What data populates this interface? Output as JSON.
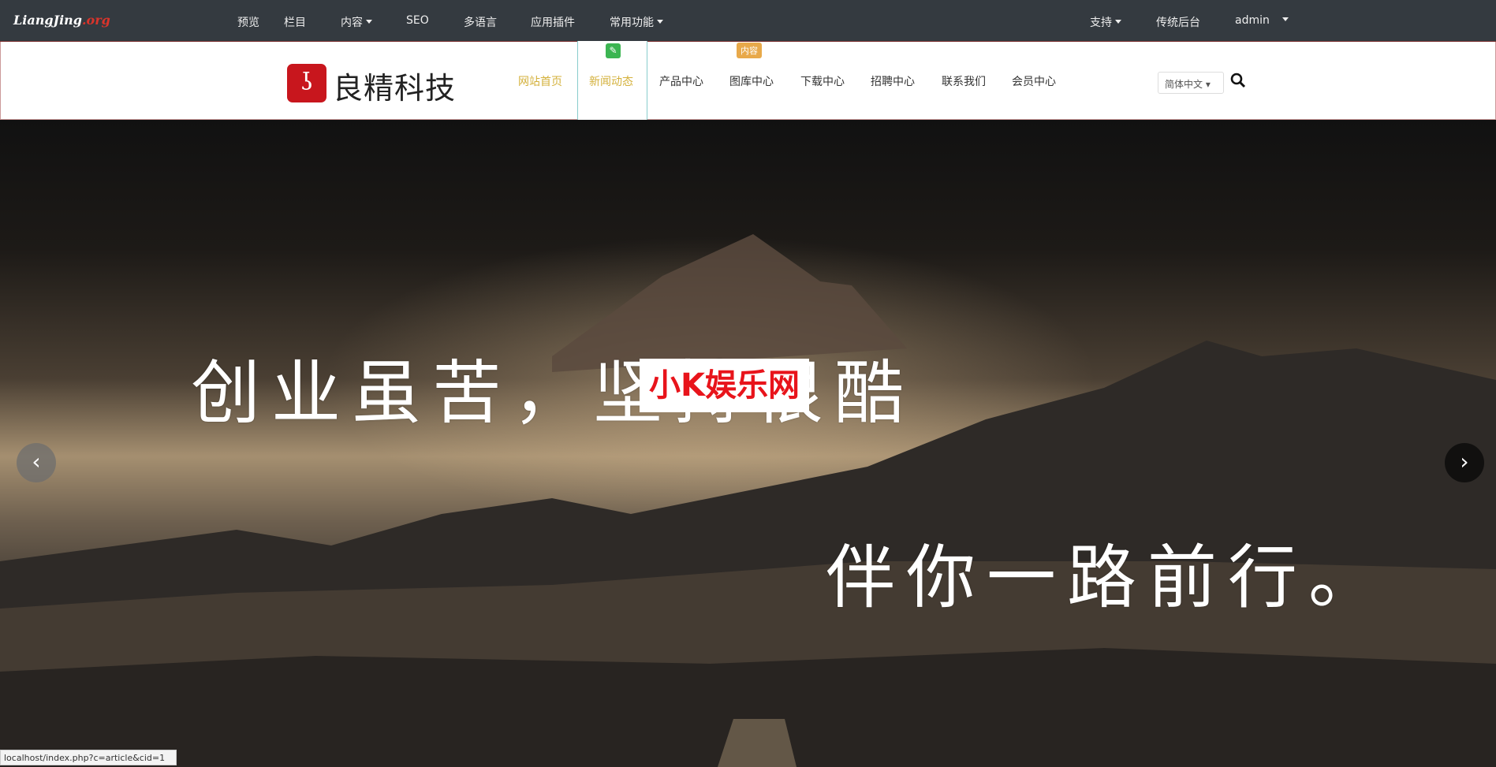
{
  "topbar": {
    "brand_main": "LiangJing",
    "brand_suffix": ".org",
    "items": [
      {
        "label": "预览"
      },
      {
        "label": "栏目"
      },
      {
        "label": "内容"
      },
      {
        "label": "SEO"
      },
      {
        "label": "多语言"
      },
      {
        "label": "应用插件"
      },
      {
        "label": "常用功能"
      }
    ],
    "right": [
      {
        "label": "支持"
      },
      {
        "label": "传统后台"
      },
      {
        "label": "admin"
      }
    ]
  },
  "header": {
    "logo_text": "良精科技",
    "nav": [
      {
        "label": "网站首页"
      },
      {
        "label": "新闻动态"
      },
      {
        "label": "产品中心"
      },
      {
        "label": "图库中心"
      },
      {
        "label": "下载中心"
      },
      {
        "label": "招聘中心"
      },
      {
        "label": "联系我们"
      },
      {
        "label": "会员中心"
      }
    ],
    "content_badge": "内容",
    "language": "简体中文",
    "accent": "#d4b13c"
  },
  "hero": {
    "line1": "创业虽苦，坚持很酷",
    "line2": "伴你一路前行。",
    "watermark": "小K娱乐网"
  },
  "status_url": "localhost/index.php?c=article&cid=1"
}
